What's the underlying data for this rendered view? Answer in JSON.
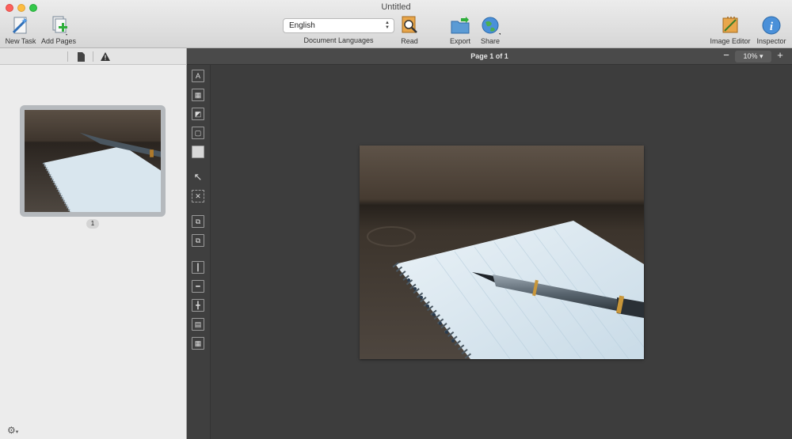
{
  "window": {
    "title": "Untitled"
  },
  "toolbar": {
    "new_task": "New Task",
    "add_pages": "Add Pages",
    "language_value": "English",
    "language_label": "Document Languages",
    "read": "Read",
    "export": "Export",
    "share": "Share",
    "image_editor": "Image Editor",
    "inspector": "Inspector"
  },
  "page_status": {
    "label": "Page 1 of 1"
  },
  "zoom": {
    "value": "10%",
    "minus": "−",
    "plus": "+"
  },
  "sidebar": {
    "pages": [
      {
        "number": "1"
      }
    ]
  },
  "tools": [
    "text-area-icon",
    "table-area-icon",
    "picture-area-icon",
    "recognition-area-icon",
    "background-picture-icon",
    "select-tool-icon",
    "delete-area-icon",
    "add-area-icon",
    "remove-area-icon",
    "insert-column-icon",
    "insert-row-icon",
    "merge-cells-icon",
    "split-cells-icon",
    "table-grid-icon"
  ],
  "colors": {
    "canvas": "#3d3d3d",
    "toolbar": "#dcdcdc",
    "sidebar": "#ececec"
  }
}
